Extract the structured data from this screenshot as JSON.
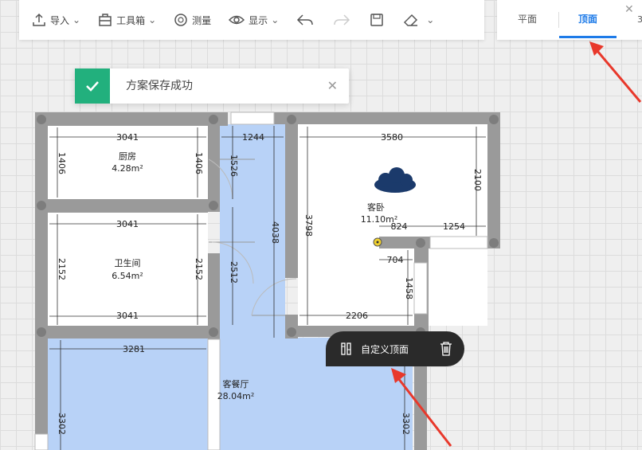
{
  "toolbar": {
    "import_label": "导入",
    "toolbox_label": "工具箱",
    "measure_label": "测量",
    "display_label": "显示"
  },
  "view_tabs": {
    "plan": "平面",
    "top": "顶面",
    "threed": "3"
  },
  "toast": {
    "message": "方案保存成功"
  },
  "context_menu": {
    "custom_ceiling": "自定义顶面"
  },
  "floorplan": {
    "rooms": {
      "kitchen": {
        "name": "厨房",
        "area": "4.28m²"
      },
      "bathroom": {
        "name": "卫生间",
        "area": "6.54m²"
      },
      "bedroom": {
        "name": "客卧",
        "area": "11.10m²"
      },
      "living": {
        "name": "客餐厅",
        "area": "28.04m²"
      }
    },
    "dims": {
      "k_top": "3041",
      "k_left": "1406",
      "k_right": "1406",
      "b_top": "3041",
      "b_left": "2152",
      "b_right": "2152",
      "b_bottom": "3041",
      "corr_top": "1244",
      "corr_1526": "1526",
      "corr_2512": "2512",
      "corr_4038": "4038",
      "bed_top": "3580",
      "bed_left": "3798",
      "bed_right": "2100",
      "d824": "824",
      "d1254": "1254",
      "d704": "704",
      "d1458": "1458",
      "d2206": "2206",
      "liv_top": "3281",
      "liv_left": "3302",
      "liv_right": "3302"
    }
  },
  "colors": {
    "accent": "#1e7be8",
    "success": "#22b07d",
    "wall": "#9a9a9a",
    "floor_blue": "#b8d2f7",
    "arrow": "#e8382b"
  }
}
